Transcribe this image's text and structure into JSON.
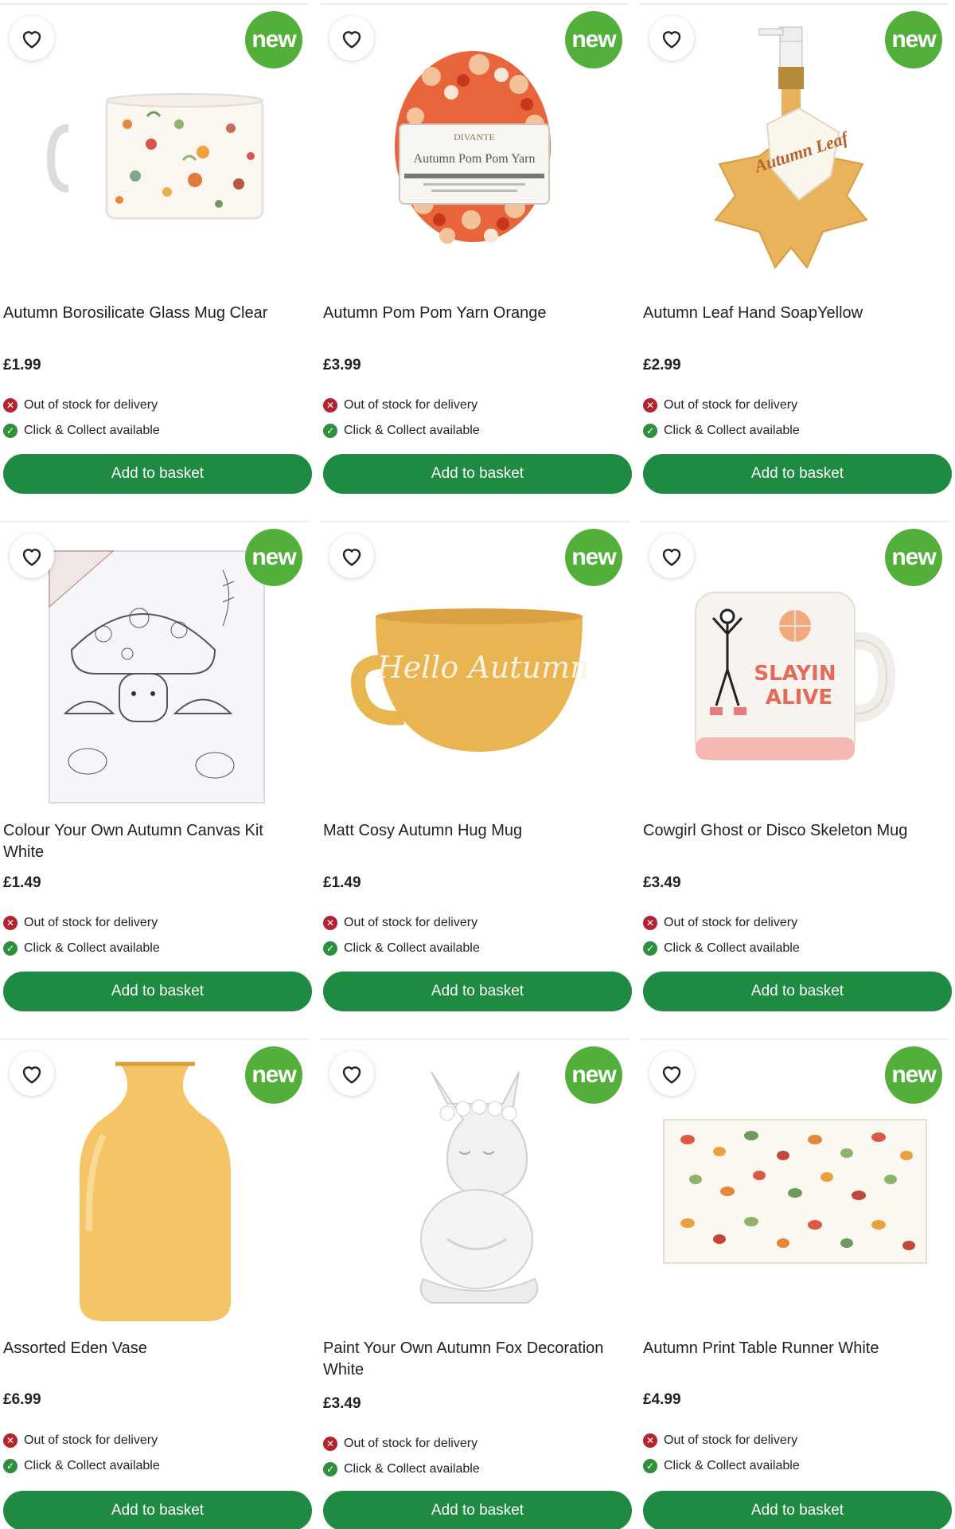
{
  "badge_label": "new",
  "colors": {
    "accent_green": "#1f8a42",
    "badge_green": "#52b03a",
    "stock_red": "#b5232e",
    "stock_green": "#2f8f3c"
  },
  "products": [
    {
      "name": "Autumn Borosilicate Glass Mug Clear",
      "price": "£1.99",
      "delivery": "Out of stock for delivery",
      "collect": "Click & Collect available",
      "cta": "Add to basket"
    },
    {
      "name": "Autumn Pom Pom Yarn Orange",
      "price": "£3.99",
      "delivery": "Out of stock for delivery",
      "collect": "Click & Collect available",
      "cta": "Add to basket",
      "label_brand": "DIVANTE",
      "label_text": "Autumn Pom Pom Yarn"
    },
    {
      "name": "Autumn Leaf Hand SoapYellow",
      "price": "£2.99",
      "delivery": "Out of stock for delivery",
      "collect": "Click & Collect available",
      "cta": "Add to basket",
      "tag_text": "Autumn Leaf"
    },
    {
      "name": "Colour Your Own Autumn Canvas Kit White",
      "price": "£1.49",
      "delivery": "Out of stock for delivery",
      "collect": "Click & Collect available",
      "cta": "Add to basket"
    },
    {
      "name": "Matt Cosy Autumn Hug Mug",
      "price": "£1.49",
      "delivery": "Out of stock for delivery",
      "collect": "Click & Collect available",
      "cta": "Add to basket",
      "mug_text": "Hello Autumn"
    },
    {
      "name": "Cowgirl Ghost or Disco Skeleton Mug",
      "price": "£3.49",
      "delivery": "Out of stock for delivery",
      "collect": "Click & Collect available",
      "cta": "Add to basket",
      "mug_text_1": "SLAYIN",
      "mug_text_2": "ALIVE"
    },
    {
      "name": "Assorted Eden Vase",
      "price": "£6.99",
      "delivery": "Out of stock for delivery",
      "collect": "Click & Collect available",
      "cta": "Add to basket"
    },
    {
      "name": "Paint Your Own Autumn Fox Decoration White",
      "price": "£3.49",
      "delivery": "Out of stock for delivery",
      "collect": "Click & Collect available",
      "cta": "Add to basket"
    },
    {
      "name": "Autumn Print Table Runner White",
      "price": "£4.99",
      "delivery": "Out of stock for delivery",
      "collect": "Click & Collect available",
      "cta": "Add to basket"
    }
  ]
}
